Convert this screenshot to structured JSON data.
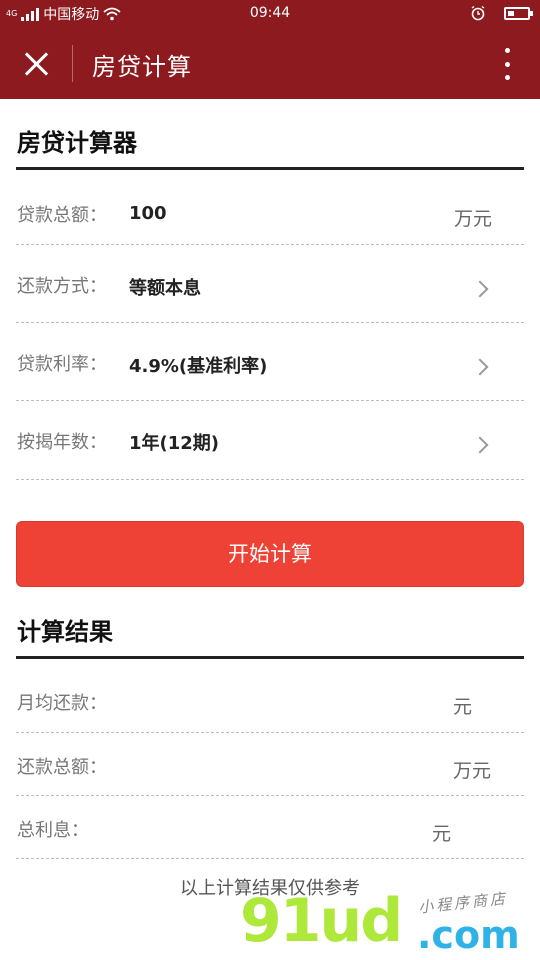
{
  "status_bar": {
    "network": "4G",
    "carrier": "中国移动",
    "time": "09:44"
  },
  "header": {
    "title": "房贷计算"
  },
  "calculator": {
    "title": "房贷计算器",
    "rows": [
      {
        "label": "贷款总额：",
        "value": "100",
        "unit": "万元"
      },
      {
        "label": "还款方式：",
        "value": "等额本息"
      },
      {
        "label": "贷款利率：",
        "value": "4.9%(基准利率)"
      },
      {
        "label": "按揭年数：",
        "value": "1年(12期)"
      }
    ],
    "button_label": "开始计算"
  },
  "results": {
    "title": "计算结果",
    "rows": [
      {
        "label": "月均还款：",
        "unit": "元"
      },
      {
        "label": "还款总额：",
        "unit": "万元"
      },
      {
        "label": "总利息：",
        "unit": "元"
      }
    ],
    "note": "以上计算结果仅供参考"
  },
  "watermark": {
    "main": "91ud",
    "suffix": ".com",
    "small": "小程序商店"
  },
  "colors": {
    "header_bg": "#8c1a1f",
    "button_bg": "#ef4236"
  }
}
